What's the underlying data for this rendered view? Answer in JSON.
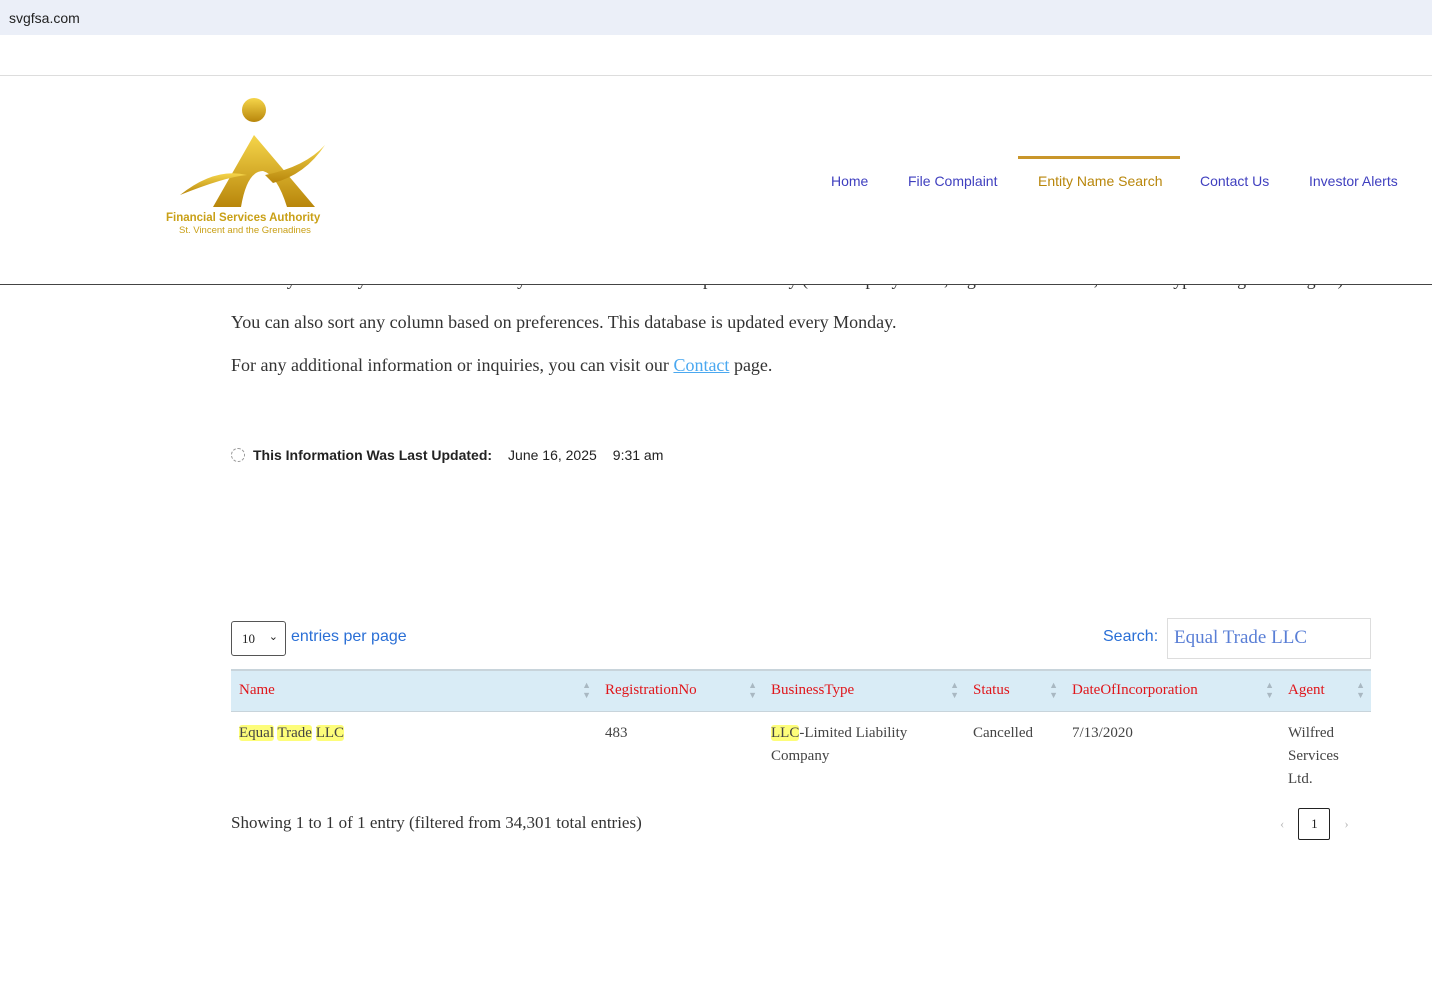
{
  "browser": {
    "url": "svgfsa.com"
  },
  "logo": {
    "line1": "Financial Services Authority",
    "line2": "St. Vincent and the Grenadines"
  },
  "nav": [
    {
      "label": "Home"
    },
    {
      "label": "File Complaint"
    },
    {
      "label": "Entity Name Search",
      "active": true
    },
    {
      "label": "Contact Us"
    },
    {
      "label": "Investor Alerts"
    }
  ],
  "intro": {
    "p1": "You may enter any information from any column to search for a specific entity (i.e. company name, registration number, business type or registered agent).",
    "p2": "You can also sort any column based on preferences. This database is updated every Monday.",
    "p3_before": "For any additional information or inquiries, you can visit our ",
    "p3_link": "Contact",
    "p3_after": " page."
  },
  "updated": {
    "label": "This Information Was Last Updated:",
    "date": "June 16, 2025",
    "time": "9:31 am"
  },
  "controls": {
    "per_page": "10",
    "per_page_label": "entries per page",
    "search_label": "Search:",
    "search_value": "Equal Trade LLC"
  },
  "table": {
    "columns": [
      "Name",
      "RegistrationNo",
      "BusinessType",
      "Status",
      "DateOfIncorporation",
      "Agent"
    ],
    "rows": [
      {
        "name_parts": [
          "Equal",
          "Trade",
          "LLC"
        ],
        "reg": "483",
        "type_hl": "LLC",
        "type_rest": "-Limited Liability Company",
        "status": "Cancelled",
        "date": "7/13/2020",
        "agent": "Wilfred Services Ltd."
      }
    ]
  },
  "footer": {
    "info": "Showing 1 to 1 of 1 entry (filtered from 34,301 total entries)",
    "prev": "‹",
    "page": "1",
    "next": "›"
  },
  "colors": {
    "accent": "#c9962a",
    "header_text": "#e0161b",
    "link": "#3f3fbf"
  }
}
